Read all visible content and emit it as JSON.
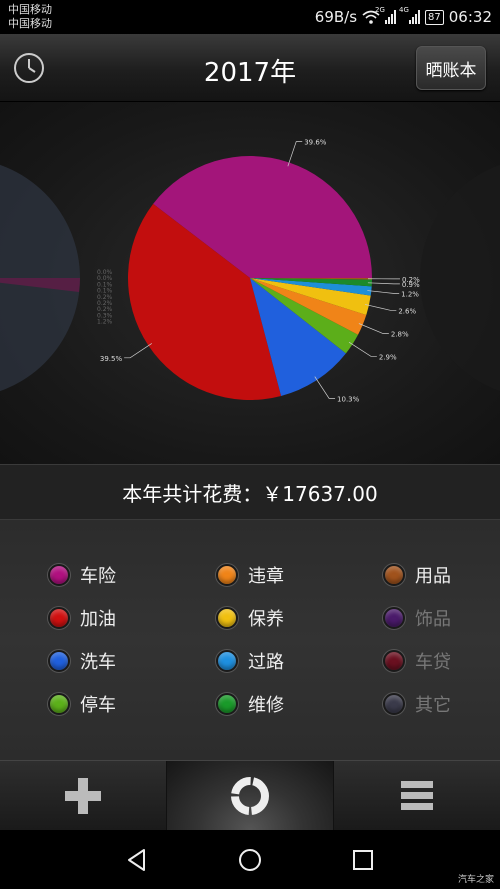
{
  "status_bar": {
    "carrier_1": "中国移动",
    "carrier_2": "中国移动",
    "speed": "69B/s",
    "sig1_tag": "2G",
    "sig2_tag": "4G",
    "battery": "87",
    "time": "06:32"
  },
  "header": {
    "title": "2017年",
    "share_label": "晒账本",
    "history_icon": "clock-icon"
  },
  "chart_data": {
    "type": "pie",
    "title": "",
    "slices": [
      {
        "category": "车险",
        "value": 39.6,
        "label": "39.6%",
        "color": "#a3157a"
      },
      {
        "category": "加油",
        "value": 39.5,
        "label": "39.5%",
        "color": "#c20e0e"
      },
      {
        "category": "洗车",
        "value": 10.3,
        "label": "10.3%",
        "color": "#2060dd"
      },
      {
        "category": "停车",
        "value": 2.9,
        "label": "2.9%",
        "color": "#5cae1a"
      },
      {
        "category": "违章",
        "value": 2.8,
        "label": "2.8%",
        "color": "#f08418"
      },
      {
        "category": "保养",
        "value": 2.6,
        "label": "2.6%",
        "color": "#f0c010"
      },
      {
        "category": "过路",
        "value": 1.2,
        "label": "1.2%",
        "color": "#1e8fd8"
      },
      {
        "category": "维修",
        "value": 0.9,
        "label": "0.9%",
        "color": "#1c8a2a"
      },
      {
        "category": "用品",
        "value": 0.2,
        "label": "0.2%",
        "color": "#a0521c"
      }
    ],
    "prev_labels": [
      "0.0%",
      "0.0%",
      "0.1%",
      "0.1%",
      "0.2%",
      "0.2%",
      "0.2%",
      "0.3%",
      "1.2%"
    ]
  },
  "total": {
    "text": "本年共计花费：￥17637.00"
  },
  "legend": [
    {
      "label": "车险",
      "color": "#b0107f",
      "dim": false
    },
    {
      "label": "违章",
      "color": "#f08418",
      "dim": false
    },
    {
      "label": "用品",
      "color": "#a0521c",
      "dim": false
    },
    {
      "label": "加油",
      "color": "#d01010",
      "dim": false
    },
    {
      "label": "保养",
      "color": "#f0c010",
      "dim": false
    },
    {
      "label": "饰品",
      "color": "#4a1a6a",
      "dim": true
    },
    {
      "label": "洗车",
      "color": "#2060dd",
      "dim": false
    },
    {
      "label": "过路",
      "color": "#1e90e0",
      "dim": false
    },
    {
      "label": "车贷",
      "color": "#6a1020",
      "dim": true
    },
    {
      "label": "停车",
      "color": "#5cb01a",
      "dim": false
    },
    {
      "label": "维修",
      "color": "#1a9a2a",
      "dim": false
    },
    {
      "label": "其它",
      "color": "#3a3a4a",
      "dim": true
    }
  ],
  "tabs": [
    {
      "icon": "plus-icon",
      "active": false
    },
    {
      "icon": "pie-chart-icon",
      "active": true
    },
    {
      "icon": "list-icon",
      "active": false
    }
  ],
  "navbar": {
    "back_icon": "back-triangle-icon",
    "home_icon": "home-circle-icon",
    "recent_icon": "recent-square-icon"
  },
  "watermark": "汽车之家"
}
